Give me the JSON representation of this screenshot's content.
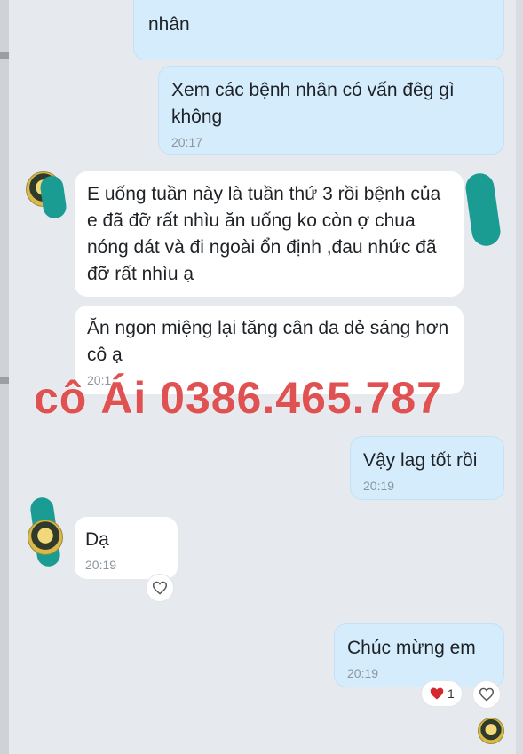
{
  "messages": [
    {
      "text": "nhân",
      "time": ""
    },
    {
      "text": "Xem các bệnh nhân có vấn đêg gì không",
      "time": "20:17"
    },
    {
      "text": "E uống tuần này là tuần thứ 3 rồi bệnh của e đã đỡ rất nhìu ăn uống ko còn ợ chua nóng dát và đi ngoài ổn định ,đau nhức đã đỡ rất nhìu ạ",
      "time": ""
    },
    {
      "text": "Ăn ngon miệng lại tăng cân da dẻ sáng hơn cô ạ",
      "time": "20:1"
    },
    {
      "text": "Vậy lag tốt rồi",
      "time": "20:19"
    },
    {
      "text": "Dạ",
      "time": "20:19"
    },
    {
      "text": "Chúc mừng em",
      "time": "20:19"
    }
  ],
  "watermark": "cô Ái 0386.465.787",
  "reactions": {
    "heart_count": "1"
  },
  "colors": {
    "outgoing_bubble": "#d4ecfb",
    "incoming_bubble": "#ffffff",
    "watermark": "#e05252",
    "background": "#e6e9ee"
  },
  "icons": [
    "heart-outline-icon",
    "heart-filled-icon",
    "avatar"
  ]
}
